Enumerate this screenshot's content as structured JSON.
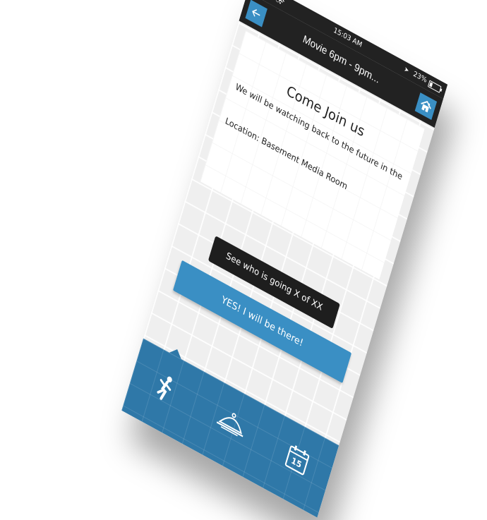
{
  "status_bar": {
    "signal": "●●○○○",
    "time": "15:03 AM",
    "battery_percent": "23%"
  },
  "nav": {
    "title": "Movie 6pm - 9pm...",
    "back_icon": "arrow-left-icon",
    "home_icon": "home-icon"
  },
  "event_card": {
    "title": "Come Join us",
    "description": "We will be watching back to the future in the",
    "location": "Location:  Basement Media Room"
  },
  "attendance_button": {
    "label": "See who is going X of XX"
  },
  "rsvp_button": {
    "label": "YES! I will be there!"
  },
  "tab_bar": {
    "tabs": [
      {
        "icon": "activity-person-icon",
        "active": true
      },
      {
        "icon": "dining-cloche-icon",
        "active": false
      },
      {
        "icon": "calendar-icon",
        "label": "15",
        "active": false
      }
    ]
  },
  "colors": {
    "accent": "#3a8fc4",
    "tab_bar": "#2f78a8",
    "header": "#222222",
    "background": "#efefef"
  }
}
